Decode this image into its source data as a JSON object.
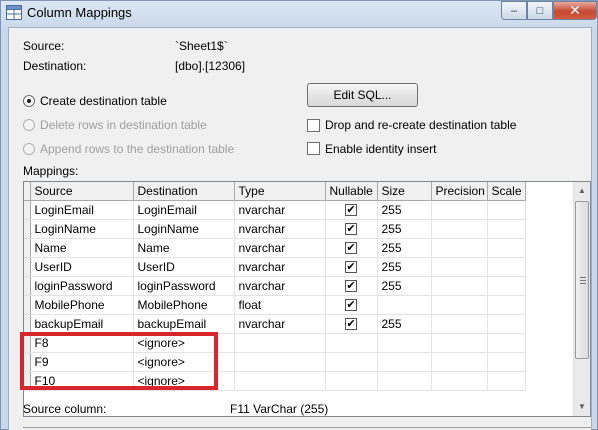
{
  "window": {
    "title": "Column Mappings",
    "controls": {
      "minimize": "–",
      "maximize": "□",
      "close": "✕"
    },
    "title_icon": "table-icon"
  },
  "info": {
    "source_label": "Source:",
    "source_value": "`Sheet1$`",
    "destination_label": "Destination:",
    "destination_value": "[dbo].[12306]"
  },
  "options": {
    "create_table": "Create destination table",
    "delete_rows": "Delete rows in destination table",
    "append_rows": "Append rows to the destination table",
    "edit_sql_button": "Edit SQL...",
    "drop_recreate": "Drop and re-create destination table",
    "enable_identity": "Enable identity insert",
    "selected_radio": "create_table"
  },
  "mappings": {
    "label": "Mappings:",
    "columns": [
      "Source",
      "Destination",
      "Type",
      "Nullable",
      "Size",
      "Precision",
      "Scale"
    ],
    "rows": [
      {
        "source": "LoginEmail",
        "destination": "LoginEmail",
        "type": "nvarchar",
        "nullable": true,
        "size": "255",
        "precision": "",
        "scale": ""
      },
      {
        "source": "LoginName",
        "destination": "LoginName",
        "type": "nvarchar",
        "nullable": true,
        "size": "255",
        "precision": "",
        "scale": ""
      },
      {
        "source": "Name",
        "destination": "Name",
        "type": "nvarchar",
        "nullable": true,
        "size": "255",
        "precision": "",
        "scale": ""
      },
      {
        "source": "UserID",
        "destination": "UserID",
        "type": "nvarchar",
        "nullable": true,
        "size": "255",
        "precision": "",
        "scale": ""
      },
      {
        "source": "loginPassword",
        "destination": "loginPassword",
        "type": "nvarchar",
        "nullable": true,
        "size": "255",
        "precision": "",
        "scale": ""
      },
      {
        "source": "MobilePhone",
        "destination": "MobilePhone",
        "type": "float",
        "nullable": true,
        "size": "",
        "precision": "",
        "scale": ""
      },
      {
        "source": "backupEmail",
        "destination": "backupEmail",
        "type": "nvarchar",
        "nullable": true,
        "size": "255",
        "precision": "",
        "scale": ""
      },
      {
        "source": "F8",
        "destination": "<ignore>",
        "type": "",
        "nullable": false,
        "size": "",
        "precision": "",
        "scale": ""
      },
      {
        "source": "F9",
        "destination": "<ignore>",
        "type": "",
        "nullable": false,
        "size": "",
        "precision": "",
        "scale": ""
      },
      {
        "source": "F10",
        "destination": "<ignore>",
        "type": "",
        "nullable": false,
        "size": "",
        "precision": "",
        "scale": ""
      }
    ],
    "check_glyph": "✔",
    "scroll_up": "▲",
    "scroll_down": "▼"
  },
  "footer": {
    "source_column_label": "Source column:",
    "source_column_value": "F11 VarChar (255)"
  },
  "colors": {
    "highlight": "#d9262c",
    "title_gradient": "#c8d7ea",
    "close_button": "#c74a32"
  }
}
